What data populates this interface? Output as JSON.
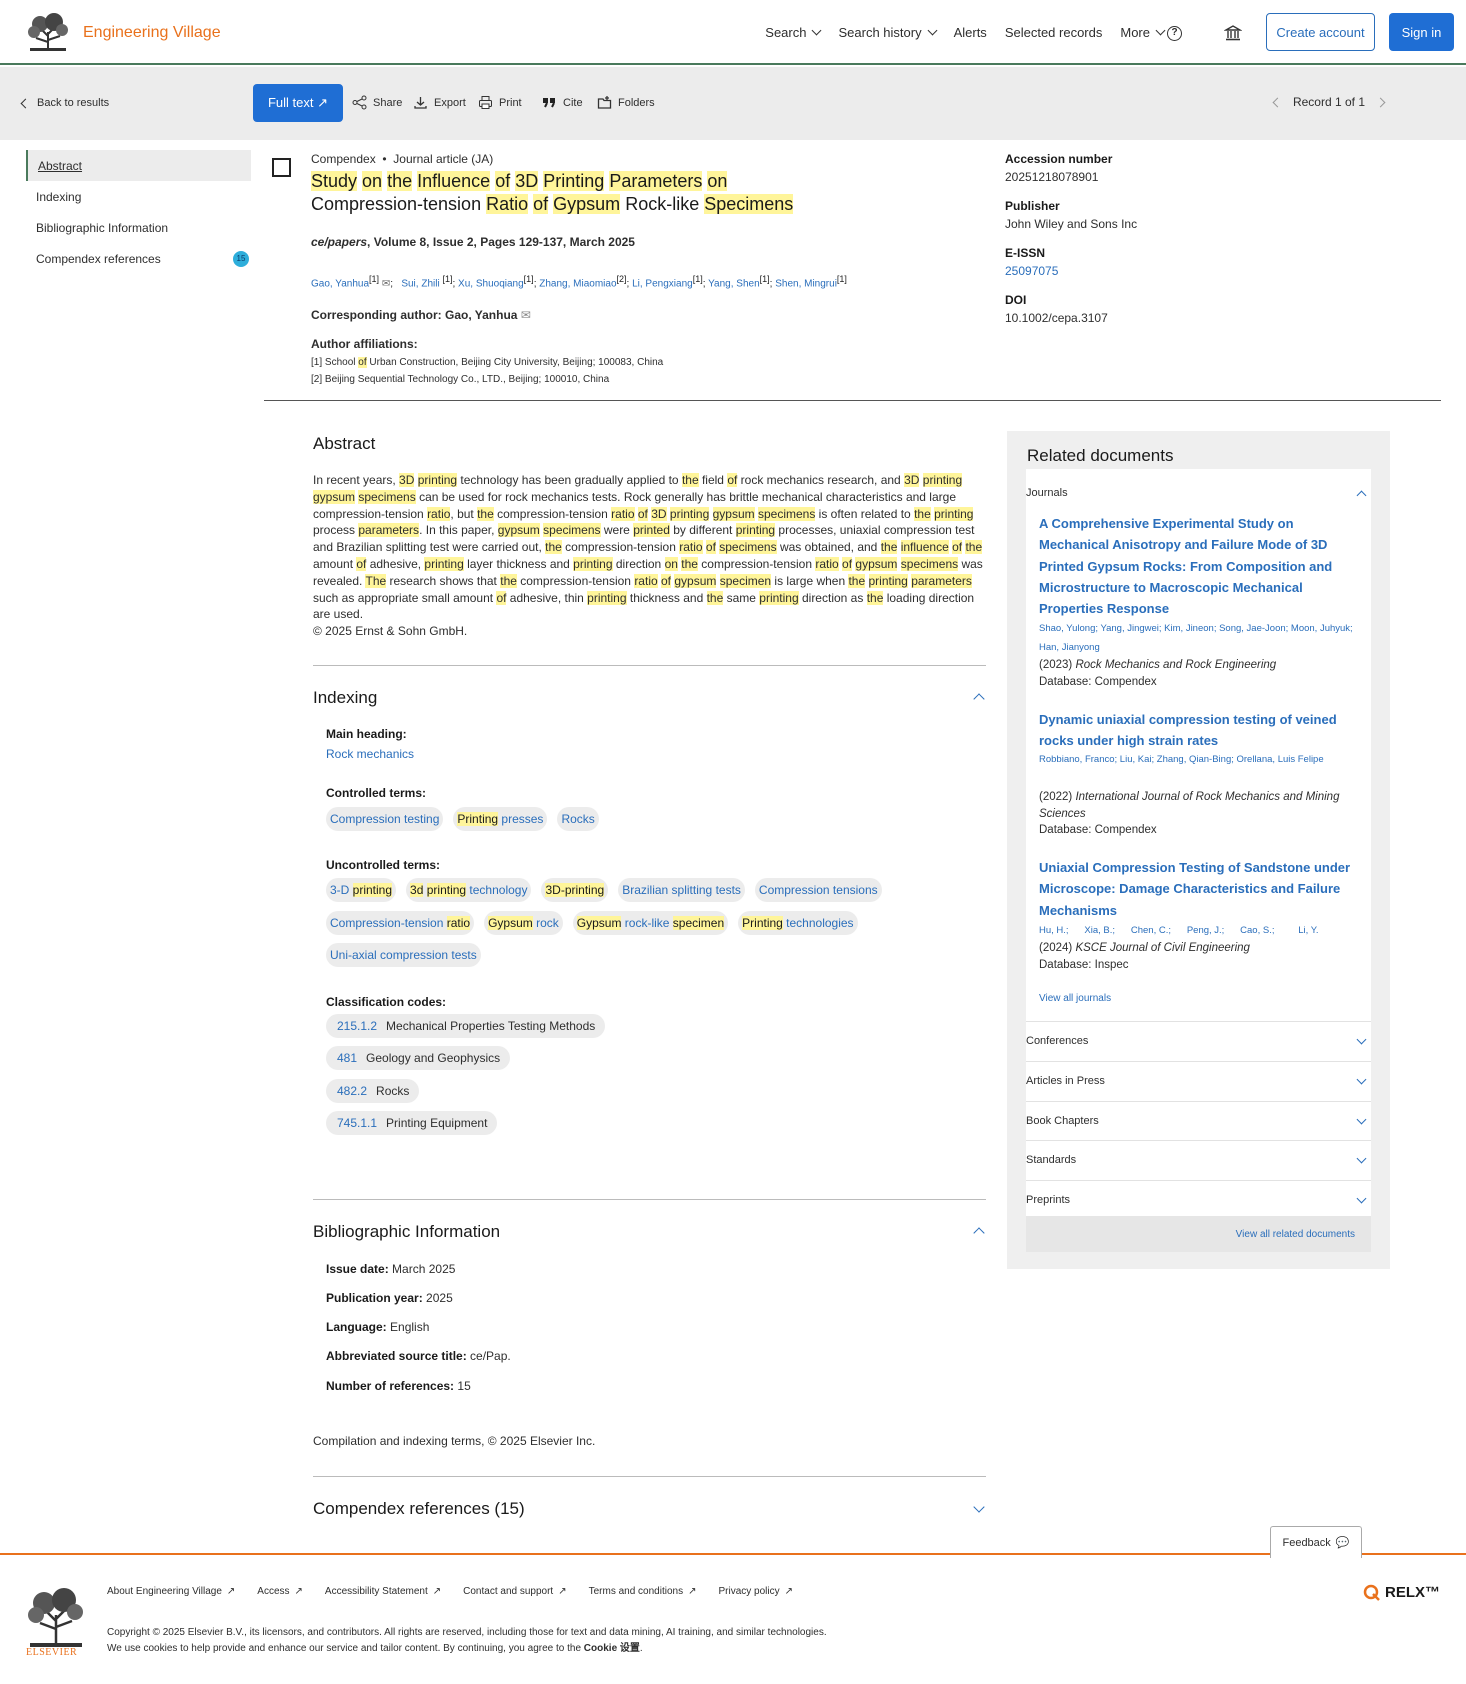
{
  "header": {
    "brand": "Engineering Village",
    "nav": [
      "Search",
      "Search history",
      "Alerts",
      "Selected records",
      "More"
    ],
    "help_icon": "?",
    "create_account": "Create account",
    "sign_in": "Sign in"
  },
  "toolbar": {
    "back": "Back to results",
    "full_text": "Full text",
    "share": "Share",
    "export": "Export",
    "print": "Print",
    "cite": "Cite",
    "folders": "Folders",
    "record": "Record 1 of 1"
  },
  "side_nav": {
    "items": [
      "Abstract",
      "Indexing",
      "Bibliographic Information",
      "Compendex references"
    ],
    "badge": "15"
  },
  "record": {
    "source_db": "Compendex",
    "doc_type": "Journal article (JA)",
    "source_journal": "ce/papers",
    "source_details": ", Volume 8, Issue 2, Pages 129-137, March 2025",
    "authors": [
      {
        "name": "Gao, Yanhua",
        "aff": "[1]"
      },
      {
        "name": "Sui, Zhili",
        "aff": "[1]"
      },
      {
        "name": "Xu, Shuoqiang",
        "aff": "[1]"
      },
      {
        "name": "Zhang, Miaomiao",
        "aff": "[2]"
      },
      {
        "name": "Li, Pengxiang",
        "aff": "[1]"
      },
      {
        "name": "Yang, Shen",
        "aff": "[1]"
      },
      {
        "name": "Shen, Mingrui",
        "aff": "[1]"
      }
    ],
    "corresponding": "Corresponding author: Gao, Yanhua",
    "affil_title": "Author affiliations:",
    "affiliations": [
      "[1] School of Urban Construction, Beijing City University, Beijing; 100083, China",
      "[2] Beijing Sequential Technology Co., LTD., Beijing; 100010, China"
    ]
  },
  "meta": {
    "accession_label": "Accession number",
    "accession": "20251218078901",
    "publisher_label": "Publisher",
    "publisher": "John Wiley and Sons Inc",
    "eissn_label": "E-ISSN",
    "eissn": "25097075",
    "doi_label": "DOI",
    "doi": "10.1002/cepa.3107"
  },
  "abstract": {
    "title": "Abstract",
    "copyright": "© 2025 Ernst & Sohn GmbH."
  },
  "indexing": {
    "title": "Indexing",
    "main_heading_label": "Main heading:",
    "main_heading": "Rock mechanics",
    "controlled_label": "Controlled terms:",
    "uncontrolled_label": "Uncontrolled terms:",
    "classification_label": "Classification codes:",
    "classification": [
      {
        "code": "215.1.2",
        "name": "Mechanical Properties Testing Methods"
      },
      {
        "code": "481",
        "name": "Geology and Geophysics"
      },
      {
        "code": "482.2",
        "name": "Rocks"
      },
      {
        "code": "745.1.1",
        "name": "Printing Equipment"
      }
    ]
  },
  "bibliographic": {
    "title": "Bibliographic Information",
    "rows": [
      {
        "label": "Issue date:",
        "value": "March 2025"
      },
      {
        "label": "Publication year:",
        "value": "2025"
      },
      {
        "label": "Language:",
        "value": "English"
      },
      {
        "label": "Abbreviated source title:",
        "value": "ce/Pap."
      },
      {
        "label": "Number of references:",
        "value": "15"
      }
    ],
    "compilation": "Compilation and indexing terms, © 2025 Elsevier Inc."
  },
  "references": {
    "title": "Compendex references (15)"
  },
  "related": {
    "title": "Related documents",
    "journals_label": "Journals",
    "docs": [
      {
        "title": "A Comprehensive Experimental Study on Mechanical Anisotropy and Failure Mode of 3D Printed Gypsum Rocks: From Composition and Microstructure to Macroscopic Mechanical Properties Response",
        "authors": "Shao, Yulong; Yang, Jingwei; Kim, Jineon; Song, Jae-Joon; Moon, Juhyuk; Han, Jianyong",
        "year": "(2023)",
        "journal": "Rock Mechanics and Rock Engineering",
        "db": "Database: Compendex"
      },
      {
        "title": "Dynamic uniaxial compression testing of veined rocks under high strain rates",
        "authors": "Robbiano, Franco;   Liu, Kai;   Zhang, Qian-Bing; Orellana, Luis Felipe",
        "year": "(2022)",
        "journal": "International Journal of Rock Mechanics and Mining Sciences",
        "db": "Database: Compendex"
      },
      {
        "title": "Uniaxial Compression Testing of Sandstone under Microscope: Damage Characteristics and Failure Mechanisms",
        "authors": "Hu, H.;      Xia, B.;      Chen, C.;      Peng, J.;      Cao, S.;         Li, Y.",
        "year": "(2024)",
        "journal": "KSCE Journal of Civil Engineering",
        "db": "Database: Inspec"
      }
    ],
    "view_all_journals": "View all journals",
    "categories": [
      "Conferences",
      "Articles in Press",
      "Book Chapters",
      "Standards",
      "Preprints"
    ],
    "view_all": "View all related documents"
  },
  "footer": {
    "links": [
      "About Engineering Village",
      "Access",
      "Accessibility Statement",
      "Contact and support",
      "Terms and conditions",
      "Privacy policy"
    ],
    "copyright_line1": "Copyright © 2025 Elsevier B.V., its licensors, and contributors. All rights are reserved, including those for text and data mining, AI training, and similar technologies.",
    "copyright_line2_prefix": "We use cookies to help provide and enhance our service and tailor content. By continuing, you agree to the",
    "copyright_line2_link": "Cookie 设置",
    "elsevier": "ELSEVIER",
    "relx": "RELX™",
    "feedback": "Feedback"
  }
}
